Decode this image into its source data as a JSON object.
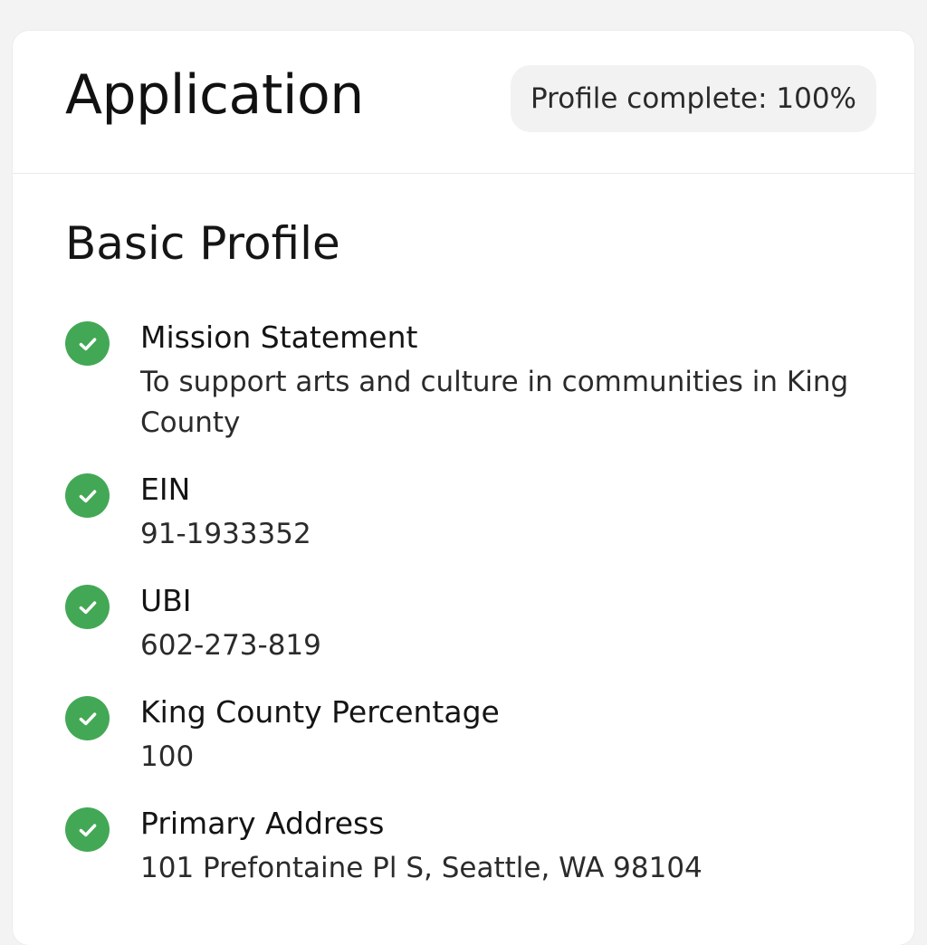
{
  "header": {
    "title": "Application",
    "progress_label": "Profile complete: 100%",
    "progress_percent": 100
  },
  "section": {
    "title": "Basic Profile"
  },
  "fields": [
    {
      "label": "Mission Statement",
      "value": "To support arts and culture in communities in King County",
      "status": "complete",
      "icon": "check-circle-icon"
    },
    {
      "label": "EIN",
      "value": "91-1933352",
      "status": "complete",
      "icon": "check-circle-icon"
    },
    {
      "label": "UBI",
      "value": "602-273-819",
      "status": "complete",
      "icon": "check-circle-icon"
    },
    {
      "label": "King County Percentage",
      "value": "100",
      "status": "complete",
      "icon": "check-circle-icon"
    },
    {
      "label": "Primary Address",
      "value": "101 Prefontaine Pl S, Seattle, WA 98104",
      "status": "complete",
      "icon": "check-circle-icon"
    }
  ],
  "colors": {
    "complete": "#43a855",
    "pill_background": "#f2f2f2",
    "page_background": "#f3f3f3"
  }
}
